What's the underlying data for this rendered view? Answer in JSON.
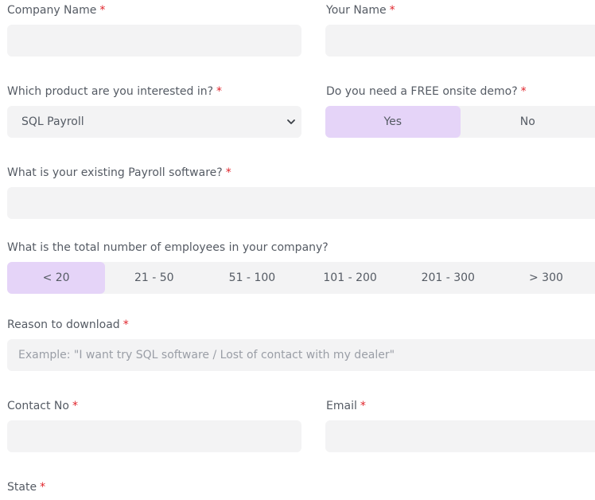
{
  "required_mark": "*",
  "company_name": {
    "label": "Company Name",
    "value": ""
  },
  "your_name": {
    "label": "Your Name",
    "value": ""
  },
  "product": {
    "label": "Which product are you interested in?",
    "selected": "SQL Payroll"
  },
  "demo": {
    "label": "Do you need a FREE onsite demo?",
    "options": [
      "Yes",
      "No"
    ],
    "selected": "Yes"
  },
  "existing_software": {
    "label": "What is your existing Payroll software?",
    "value": ""
  },
  "employees": {
    "label": "What is the total number of employees in your company?",
    "options": [
      "< 20",
      "21 - 50",
      "51 - 100",
      "101 - 200",
      "201 - 300",
      "> 300"
    ],
    "selected": "< 20"
  },
  "reason": {
    "label": "Reason to download",
    "placeholder": "Example: \"I want try SQL software / Lost of contact with my dealer\"",
    "value": ""
  },
  "contact_no": {
    "label": "Contact No",
    "value": ""
  },
  "email": {
    "label": "Email",
    "value": ""
  },
  "state": {
    "label": "State"
  },
  "colors": {
    "field_bg": "#f3f3f4",
    "selected_bg": "#e5d4f8",
    "required": "#e0242b",
    "text": "#555b64",
    "placeholder": "#9a9ea6"
  },
  "icons": {
    "select_arrow": "chevron-down-icon"
  }
}
